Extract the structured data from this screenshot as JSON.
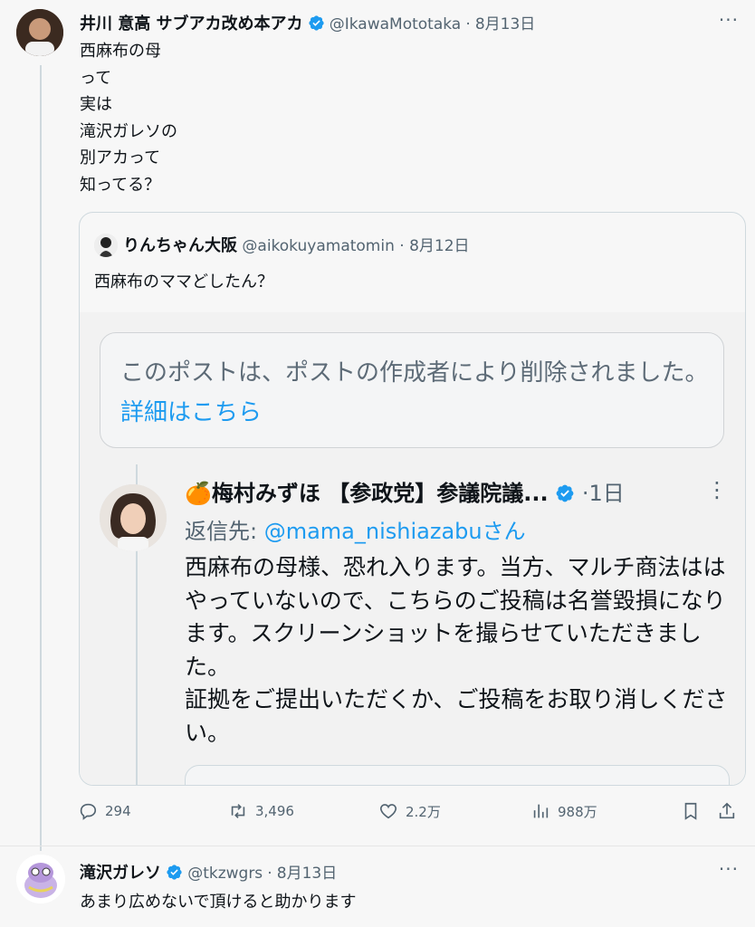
{
  "tweet1": {
    "name": "井川 意高 サブアカ改め本アカ",
    "handle": "@IkawaMototaka",
    "dot": "·",
    "date": "8月13日",
    "more": "···",
    "text": "西麻布の母\nって\n実は\n滝沢ガレソの\n別アカって\n知ってる？"
  },
  "quote": {
    "name": "りんちゃん大阪",
    "handle": "@aikokuyamatomin",
    "dot": "·",
    "date": "8月12日",
    "text": "西麻布のママどしたん？",
    "image": {
      "deleted_text": "このポストは、ポストの作成者により削除されました。",
      "deleted_link": "詳細はこちら",
      "inner_name": "🍊梅村みずほ 【参政党】参議院議...",
      "inner_time": "·1日",
      "inner_more": "⋮",
      "reply_prefix": "返信先: ",
      "reply_handle": "@mama_nishiazabu",
      "reply_suffix": "さん",
      "inner_body": "西麻布の母様、恐れ入ります。当方、マルチ商法ははやっていないので、こちらのご投稿は名誉毀損になります。スクリーンショットを撮らせていただきました。\n証拠をご提出いただくか、ご投稿をお取り消しください。"
    }
  },
  "actions": {
    "replies": "294",
    "retweets": "3,496",
    "likes": "2.2万",
    "views": "988万"
  },
  "tweet2": {
    "name": "滝沢ガレソ",
    "handle": "@tkzwgrs",
    "dot": "·",
    "date": "8月13日",
    "more": "···",
    "text": "あまり広めないで頂けると助かります"
  },
  "colors": {
    "accent": "#1d9bf0",
    "muted": "#536471"
  }
}
